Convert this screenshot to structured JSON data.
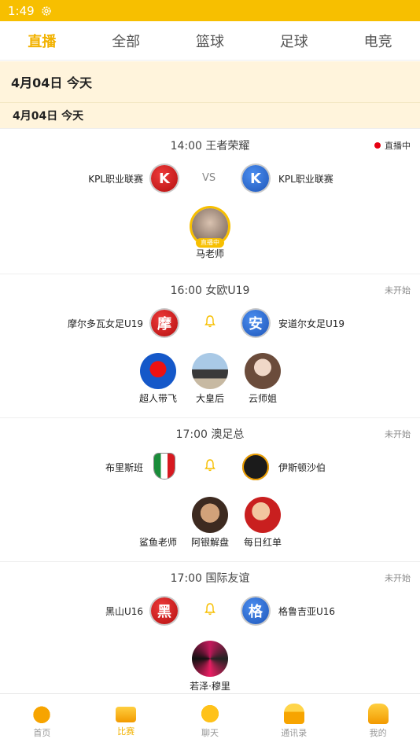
{
  "status_bar": {
    "time": "1:49",
    "icon": "gear-icon"
  },
  "tabs": [
    {
      "label": "直播",
      "active": true
    },
    {
      "label": "全部",
      "active": false
    },
    {
      "label": "篮球",
      "active": false
    },
    {
      "label": "足球",
      "active": false
    },
    {
      "label": "电竞",
      "active": false
    }
  ],
  "date_header_main": "4月04日  今天",
  "date_header_sub": "4月04日   今天",
  "matches": [
    {
      "time_league": "14:00 王者荣耀",
      "status": "直播中",
      "home": {
        "name": "KPL职业联赛",
        "badge": "K"
      },
      "away": {
        "name": "KPL职业联赛",
        "badge": "K"
      },
      "vs": "VS",
      "hosts": [
        {
          "name": "马老师",
          "chip": "直播中"
        }
      ]
    },
    {
      "time_league": "16:00 女欧U19",
      "status": "未开始",
      "home": {
        "name": "摩尔多瓦女足U19",
        "badge": "摩"
      },
      "away": {
        "name": "安道尔女足U19",
        "badge": "安"
      },
      "hosts": [
        {
          "name": "超人带飞"
        },
        {
          "name": "大皇后"
        },
        {
          "name": "云师姐"
        }
      ]
    },
    {
      "time_league": "17:00 澳足总",
      "status": "未开始",
      "home": {
        "name": "布里斯班"
      },
      "away": {
        "name": "伊斯顿沙伯"
      },
      "hosts": [
        {
          "name": "鲨鱼老师"
        },
        {
          "name": "阿银解盘"
        },
        {
          "name": "每日红单"
        }
      ]
    },
    {
      "time_league": "17:00 国际友谊",
      "status": "未开始",
      "home": {
        "name": "黑山U16",
        "badge": "黑"
      },
      "away": {
        "name": "格鲁吉亚U16",
        "badge": "格"
      },
      "hosts": [
        {
          "name": "若泽·穆里"
        }
      ]
    }
  ],
  "bottom_nav": [
    {
      "label": "首页",
      "active": false
    },
    {
      "label": "比赛",
      "active": true
    },
    {
      "label": "聊天",
      "active": false
    },
    {
      "label": "通讯录",
      "active": false
    },
    {
      "label": "我的",
      "active": false
    }
  ],
  "colors": {
    "accent": "#f7bf00",
    "live_dot": "#e60012",
    "date_bg": "#fff4dc"
  }
}
